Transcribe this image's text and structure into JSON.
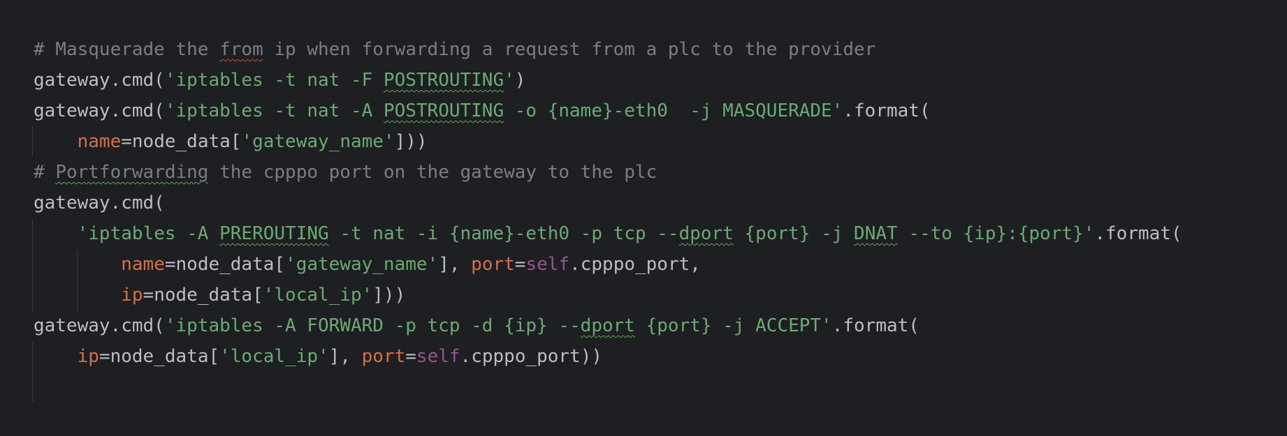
{
  "colors": {
    "background": "#1e1f22",
    "comment": "#7a7e85",
    "default_text": "#bcbec4",
    "string": "#6aab73",
    "keyword_param": "#d56f4b",
    "self_keyword": "#94558d",
    "typo_underline": "#5ea95e",
    "error_underline": "#c74f4f"
  },
  "lines": [
    {
      "tokens": [
        {
          "t": "# Masquerade the ",
          "c": "comment"
        },
        {
          "t": "from",
          "c": "comment",
          "u": "red"
        },
        {
          "t": " ip when forwarding a request from a plc to the provider",
          "c": "comment"
        }
      ]
    },
    {
      "tokens": [
        {
          "t": "gateway.cmd(",
          "c": "text"
        },
        {
          "t": "'iptables -t nat -F ",
          "c": "string"
        },
        {
          "t": "POSTROUTING",
          "c": "string",
          "u": "green"
        },
        {
          "t": "'",
          "c": "string"
        },
        {
          "t": ")",
          "c": "text"
        }
      ]
    },
    {
      "tokens": [
        {
          "t": "gateway.cmd(",
          "c": "text"
        },
        {
          "t": "'iptables -t nat -A ",
          "c": "string"
        },
        {
          "t": "POSTROUTING",
          "c": "string",
          "u": "green"
        },
        {
          "t": " -o {name}-eth0  -j MASQUERADE'",
          "c": "string"
        },
        {
          "t": ".format(",
          "c": "text"
        }
      ]
    },
    {
      "tokens": [
        {
          "t": "    ",
          "c": "text"
        },
        {
          "t": "name",
          "c": "param"
        },
        {
          "t": "=node_data[",
          "c": "text"
        },
        {
          "t": "'gateway_name'",
          "c": "string"
        },
        {
          "t": "]))",
          "c": "text"
        }
      ]
    },
    {
      "tokens": [
        {
          "t": "# ",
          "c": "comment"
        },
        {
          "t": "Portforwarding",
          "c": "comment",
          "u": "green"
        },
        {
          "t": " the cpppo port on the gateway to the plc",
          "c": "comment"
        }
      ]
    },
    {
      "tokens": [
        {
          "t": "gateway.cmd(",
          "c": "text"
        }
      ]
    },
    {
      "tokens": [
        {
          "t": "    ",
          "c": "text"
        },
        {
          "t": "'iptables -A ",
          "c": "string"
        },
        {
          "t": "PREROUTING",
          "c": "string",
          "u": "green"
        },
        {
          "t": " -t nat -i {name}-eth0 -p tcp --",
          "c": "string"
        },
        {
          "t": "dport",
          "c": "string",
          "u": "green"
        },
        {
          "t": " {port} -j ",
          "c": "string"
        },
        {
          "t": "DNAT",
          "c": "string",
          "u": "green"
        },
        {
          "t": " --to {ip}:{port}'",
          "c": "string"
        },
        {
          "t": ".format(",
          "c": "text"
        }
      ]
    },
    {
      "tokens": [
        {
          "t": "        ",
          "c": "text"
        },
        {
          "t": "name",
          "c": "param"
        },
        {
          "t": "=node_data[",
          "c": "text"
        },
        {
          "t": "'gateway_name'",
          "c": "string"
        },
        {
          "t": "], ",
          "c": "text"
        },
        {
          "t": "port",
          "c": "param"
        },
        {
          "t": "=",
          "c": "text"
        },
        {
          "t": "self",
          "c": "self"
        },
        {
          "t": ".cpppo_port,",
          "c": "text"
        }
      ]
    },
    {
      "tokens": [
        {
          "t": "        ",
          "c": "text"
        },
        {
          "t": "ip",
          "c": "param"
        },
        {
          "t": "=node_data[",
          "c": "text"
        },
        {
          "t": "'local_ip'",
          "c": "string"
        },
        {
          "t": "]))",
          "c": "text"
        }
      ]
    },
    {
      "tokens": [
        {
          "t": "gateway.cmd(",
          "c": "text"
        },
        {
          "t": "'iptables -A FORWARD -p tcp -d {ip} --",
          "c": "string"
        },
        {
          "t": "dport",
          "c": "string",
          "u": "green"
        },
        {
          "t": " {port} -j ACCEPT'",
          "c": "string"
        },
        {
          "t": ".format(",
          "c": "text"
        }
      ]
    },
    {
      "tokens": [
        {
          "t": "    ",
          "c": "text"
        },
        {
          "t": "ip",
          "c": "param"
        },
        {
          "t": "=node_data[",
          "c": "text"
        },
        {
          "t": "'local_ip'",
          "c": "string"
        },
        {
          "t": "], ",
          "c": "text"
        },
        {
          "t": "port",
          "c": "param"
        },
        {
          "t": "=",
          "c": "text"
        },
        {
          "t": "self",
          "c": "self"
        },
        {
          "t": ".cpppo_port))",
          "c": "text"
        }
      ]
    }
  ]
}
